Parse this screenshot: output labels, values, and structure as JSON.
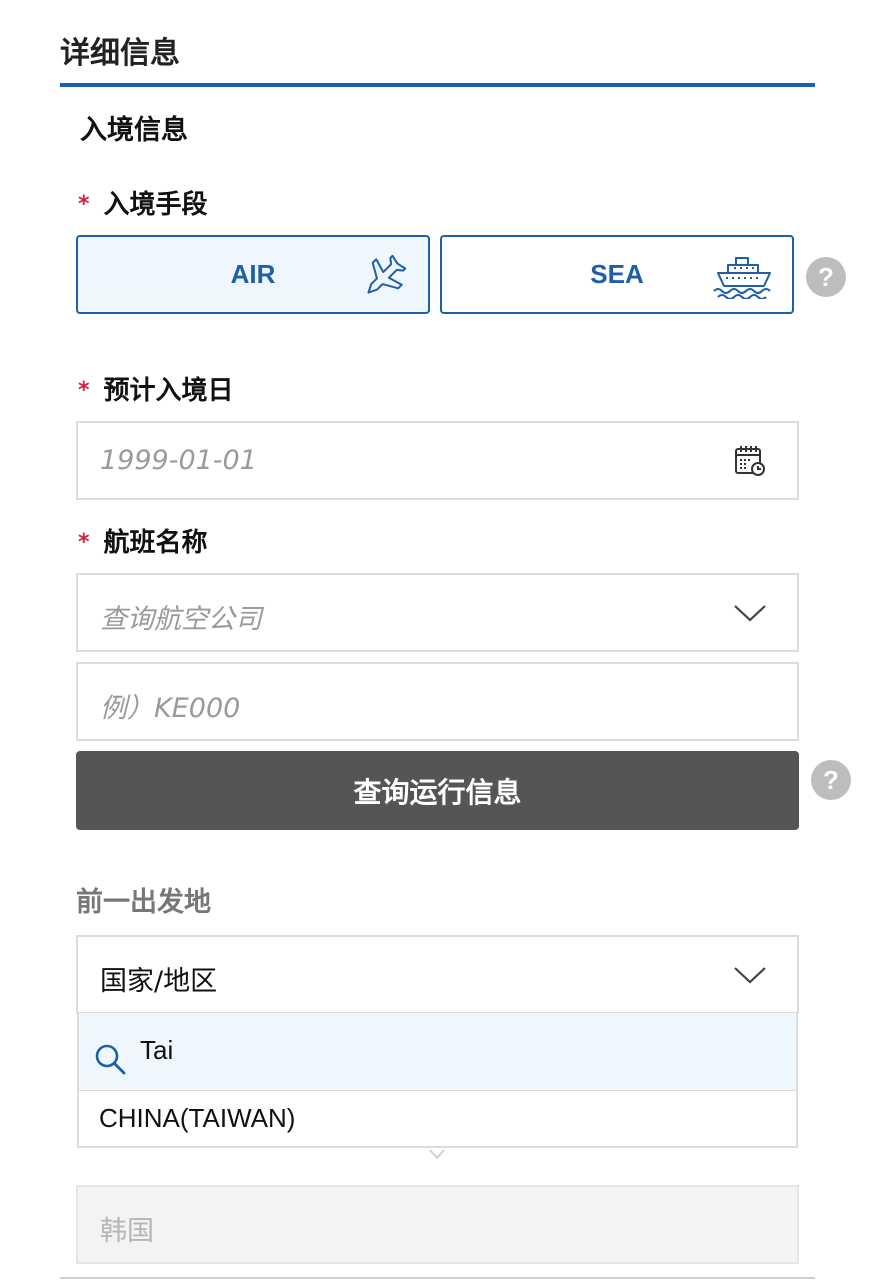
{
  "section": {
    "title": "详细信息"
  },
  "entry": {
    "subtitle": "入境信息",
    "method_label": "入境手段",
    "required_mark": "*",
    "methods": [
      {
        "label": "AIR",
        "icon": "airplane-icon",
        "selected": true
      },
      {
        "label": "SEA",
        "icon": "ship-icon",
        "selected": false
      }
    ],
    "help_glyph": "?"
  },
  "arrival_date": {
    "label": "预计入境日",
    "placeholder": "1999-01-01",
    "icon": "calendar-icon"
  },
  "flight": {
    "label": "航班名称",
    "airline_placeholder": "查询航空公司",
    "number_placeholder": "例）KE000",
    "search_button": "查询运行信息"
  },
  "departure": {
    "label": "前一出发地",
    "country_select_value": "国家/地区",
    "search_value": "Tai",
    "options": [
      "CHINA(TAIWAN)"
    ],
    "disabled_value": "韩国"
  },
  "colors": {
    "accent": "#1f5fa8",
    "selected_bg": "#eef6fe",
    "required": "#d0203a",
    "dark_button": "#555555"
  }
}
